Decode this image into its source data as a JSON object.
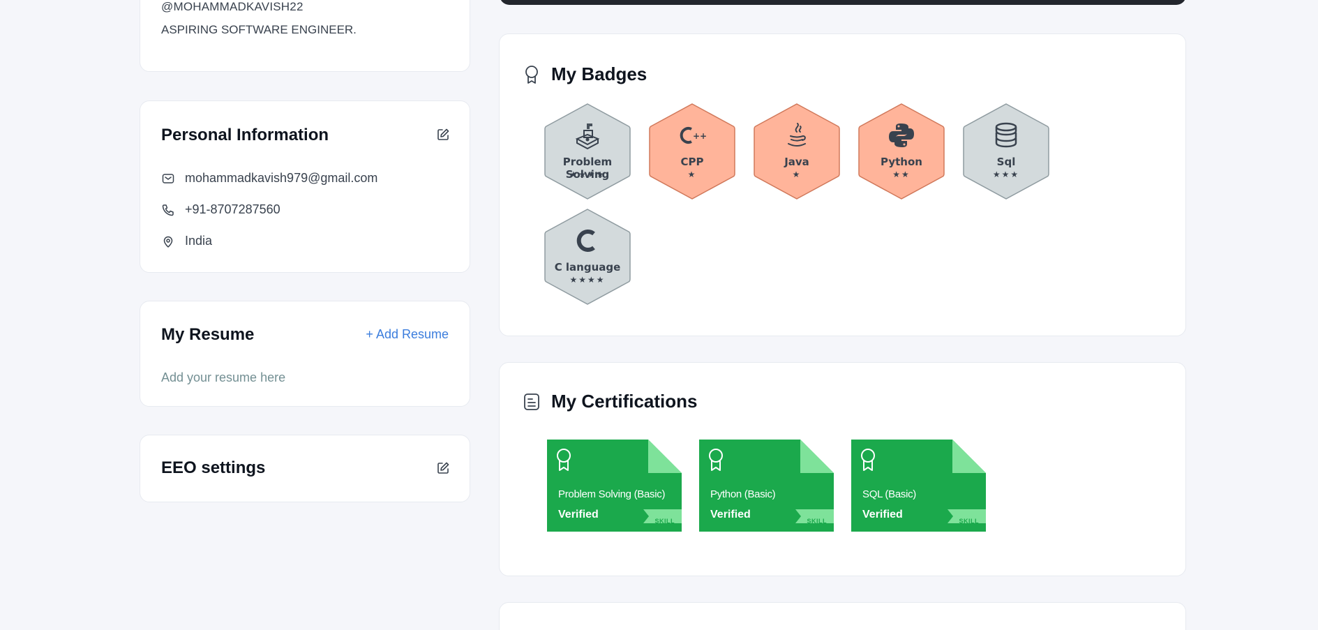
{
  "profile": {
    "handle": "@MOHAMMADKAVISH22",
    "headline": "ASPIRING SOFTWARE ENGINEER."
  },
  "personal_info": {
    "title": "Personal Information",
    "edit_icon": "edit-icon",
    "email": "mohammadkavish979@gmail.com",
    "phone": "+91-8707287560",
    "location": "India"
  },
  "resume": {
    "title": "My Resume",
    "add_label": "+ Add Resume",
    "placeholder": "Add your resume here"
  },
  "eeo": {
    "title": "EEO settings",
    "edit_icon": "edit-icon"
  },
  "badges": {
    "title": "My Badges",
    "icon": "award-icon",
    "items": [
      {
        "name": "Problem Solving",
        "stars": "★★★★",
        "tier": "silver",
        "icon": "problem-solving-icon"
      },
      {
        "name": "CPP",
        "stars": "★",
        "tier": "bronze",
        "icon": "cpp-icon"
      },
      {
        "name": "Java",
        "stars": "★",
        "tier": "bronze",
        "icon": "java-icon"
      },
      {
        "name": "Python",
        "stars": "★★",
        "tier": "bronze",
        "icon": "python-icon"
      },
      {
        "name": "Sql",
        "stars": "★★★",
        "tier": "silver",
        "icon": "database-icon"
      },
      {
        "name": "C language",
        "stars": "★★★★",
        "tier": "silver",
        "icon": "c-icon"
      }
    ]
  },
  "certifications": {
    "title": "My Certifications",
    "icon": "document-icon",
    "items": [
      {
        "name": "Problem Solving (Basic)",
        "status": "Verified",
        "tag": "SKILL"
      },
      {
        "name": "Python (Basic)",
        "status": "Verified",
        "tag": "SKILL"
      },
      {
        "name": "SQL (Basic)",
        "status": "Verified",
        "tag": "SKILL"
      }
    ]
  },
  "colors": {
    "silver_fill": "#d3dadc",
    "bronze_fill": "#ffb49a",
    "cert_green": "#1ba94c",
    "cert_corner": "#7ee29a",
    "link_blue": "#3b7ddd"
  }
}
